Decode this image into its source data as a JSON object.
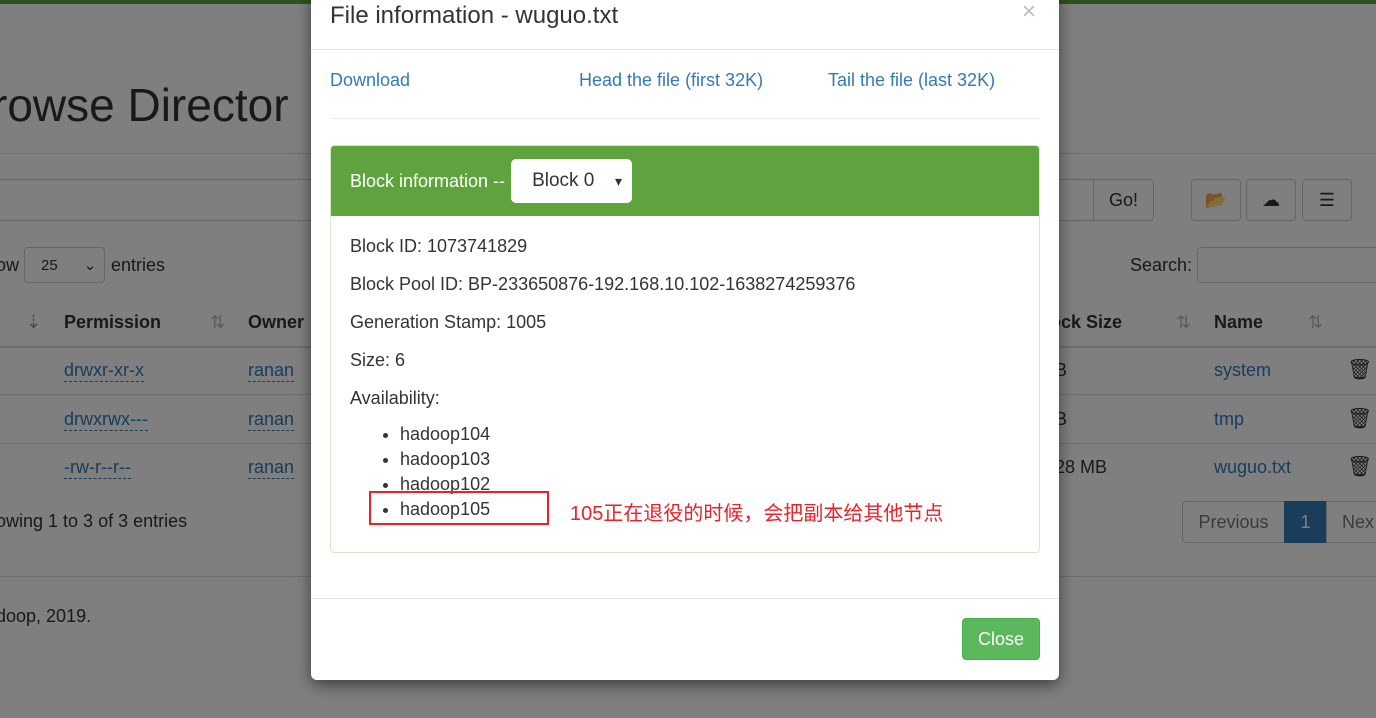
{
  "background_page": {
    "title": "rowse Director",
    "go_label": "Go!",
    "toolbar_icons": [
      "folder-open-icon",
      "cloud-upload-icon",
      "list-icon"
    ],
    "show_prefix": "ow",
    "entries_value": "25",
    "entries_suffix": "entries",
    "search_label": "Search:",
    "columns": [
      "Permission",
      "Owner",
      "ock Size",
      "Name"
    ],
    "rows": [
      {
        "permission": "drwxr-xr-x",
        "owner": "ranan",
        "block_size": "B",
        "name": "system"
      },
      {
        "permission": "drwxrwx---",
        "owner": "ranan",
        "block_size": "B",
        "name": "tmp"
      },
      {
        "permission": "-rw-r--r--",
        "owner": "ranan",
        "block_size": "28 MB",
        "name": "wuguo.txt"
      }
    ],
    "showing": "owing 1 to 3 of 3 entries",
    "pagination": {
      "previous": "Previous",
      "current": "1",
      "next": "Nex"
    },
    "footer": "doop, 2019."
  },
  "modal": {
    "title": "File information - wuguo.txt",
    "close_x": "×",
    "links": {
      "download": "Download",
      "head": "Head the file (first 32K)",
      "tail": "Tail the file (last 32K)"
    },
    "block_heading": "Block information --",
    "block_select": "Block 0",
    "block_id": "Block ID: 1073741829",
    "block_pool_id": "Block Pool ID: BP-233650876-192.168.10.102-1638274259376",
    "generation_stamp": "Generation Stamp: 1005",
    "size": "Size: 6",
    "availability_label": "Availability:",
    "availability": [
      "hadoop104",
      "hadoop103",
      "hadoop102",
      "hadoop105"
    ],
    "close_button": "Close",
    "accent_color": "#5fa33e"
  },
  "annotation": {
    "text": "105正在退役的时候，会把副本给其他节点",
    "color": "#e8222a"
  }
}
